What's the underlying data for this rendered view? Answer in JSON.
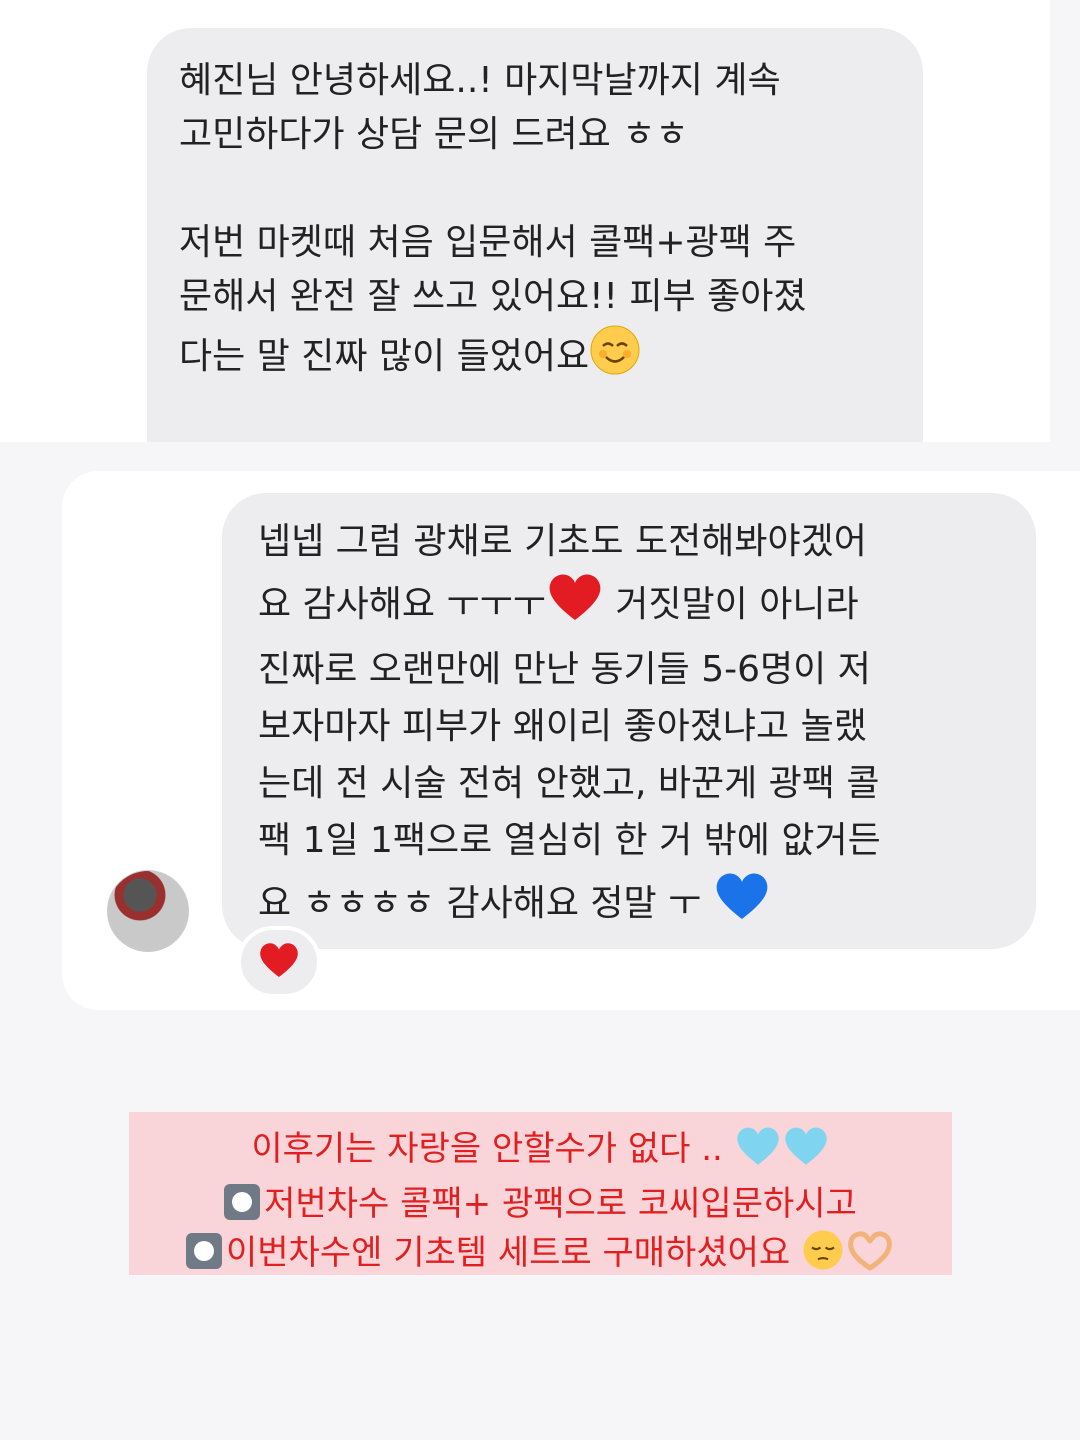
{
  "top_bubble": {
    "line1": "혜진님 안녕하세요..! 마지막날까지 계속",
    "line2": "고민하다가 상담 문의 드려요 ㅎㅎ",
    "line3": "저번 마켓때 처음 입문해서 콜팩+광팩 주",
    "line4": "문해서 완전 잘 쓰고 있어요!! 피부 좋아졌",
    "line5": "다는 말 진짜 많이 들었어요"
  },
  "mid_bubble": {
    "line1": "넵넵 그럼 광채로 기초도 도전해봐야겠어",
    "line2a": "요 감사해요 ㅜㅜㅜ",
    "line2b": " 거짓말이 아니라",
    "line3": "진짜로 오랜만에 만난 동기들 5-6명이 저",
    "line4": "보자마자 피부가 왜이리 좋아졌냐고 놀랬",
    "line5": "는데 전 시술 전혀 안했고, 바꾼게 광팩 콜",
    "line6": "팩 1일 1팩으로 열심히 한 거 밖에 앖거든",
    "line7": "요 ㅎㅎㅎㅎ 감사해요 정말 ㅜ"
  },
  "caption": {
    "line1": "이후기는 자랑을 안할수가 없다 ..",
    "line2": "저번차수 콜팩+ 광팩으로 코씨입문하시고",
    "line3": "이번차수엔 기초템 세트로 구매하셨어요"
  },
  "icons": {
    "smile": "smiling-face-icon",
    "red_heart": "red-heart-icon",
    "blue_heart": "blue-heart-icon",
    "light_blue_heart": "light-blue-heart-icon",
    "radio_button": "radio-button-icon",
    "pensive": "pensive-face-icon",
    "heart_hands": "heart-hands-icon"
  },
  "colors": {
    "bubble": "#ededf0",
    "caption_bg": "#f9d4d8",
    "caption_text": "#e02020"
  }
}
